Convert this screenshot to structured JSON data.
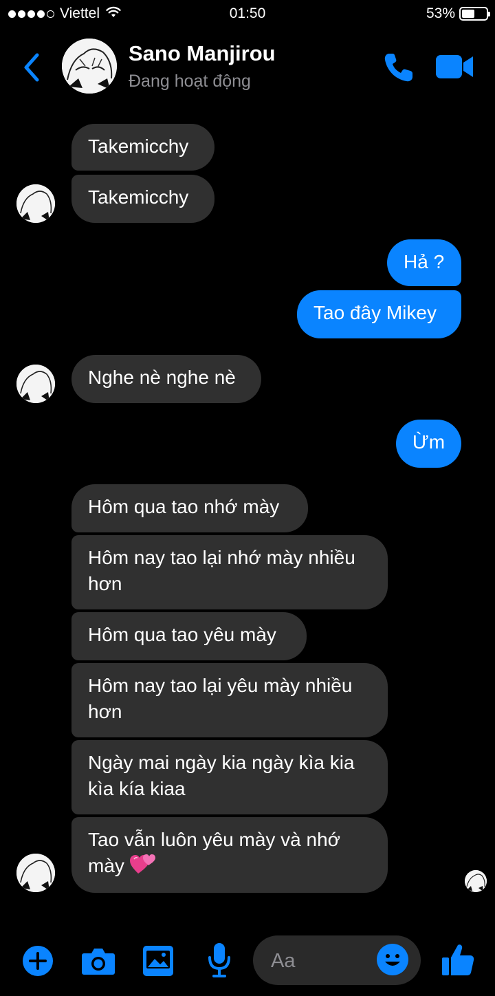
{
  "status_bar": {
    "carrier": "Viettel",
    "time": "01:50",
    "battery_percent": "53%",
    "battery_level": 0.53,
    "signal_bars_filled": 4,
    "signal_bars_total": 5
  },
  "header": {
    "contact_name": "Sano Manjirou",
    "contact_status": "Đang hoạt động"
  },
  "messages": [
    {
      "dir": "in",
      "text": "Takemicchy"
    },
    {
      "dir": "in",
      "text": "Takemicchy"
    },
    {
      "dir": "out",
      "text": "Hả ?"
    },
    {
      "dir": "out",
      "text": "Tao đây Mikey"
    },
    {
      "dir": "in",
      "text": "Nghe nè nghe nè"
    },
    {
      "dir": "out",
      "text": "Ừm"
    },
    {
      "dir": "in",
      "text": "Hôm qua tao nhớ mày"
    },
    {
      "dir": "in",
      "text": "Hôm nay tao lại nhớ mày nhiều hơn"
    },
    {
      "dir": "in",
      "text": "Hôm qua tao yêu mày"
    },
    {
      "dir": "in",
      "text": "Hôm nay tao lại yêu mày nhiều hơn"
    },
    {
      "dir": "in",
      "text": "Ngày mai ngày kia ngày kìa kia kìa kía kiaa"
    },
    {
      "dir": "in",
      "text": "Tao vẫn luôn yêu mày và nhớ mày",
      "emoji": "two-hearts"
    }
  ],
  "composer": {
    "placeholder": "Aa"
  },
  "colors": {
    "accent": "#0a84ff",
    "incoming_bubble": "#303030",
    "background": "#000000",
    "secondary_text": "#8e8e93"
  },
  "icons": {
    "back": "chevron-left-icon",
    "call": "phone-icon",
    "video": "video-camera-icon",
    "plus": "plus-circle-icon",
    "camera": "camera-icon",
    "gallery": "image-icon",
    "mic": "microphone-icon",
    "emoji": "smiley-icon",
    "like": "thumbs-up-icon"
  }
}
